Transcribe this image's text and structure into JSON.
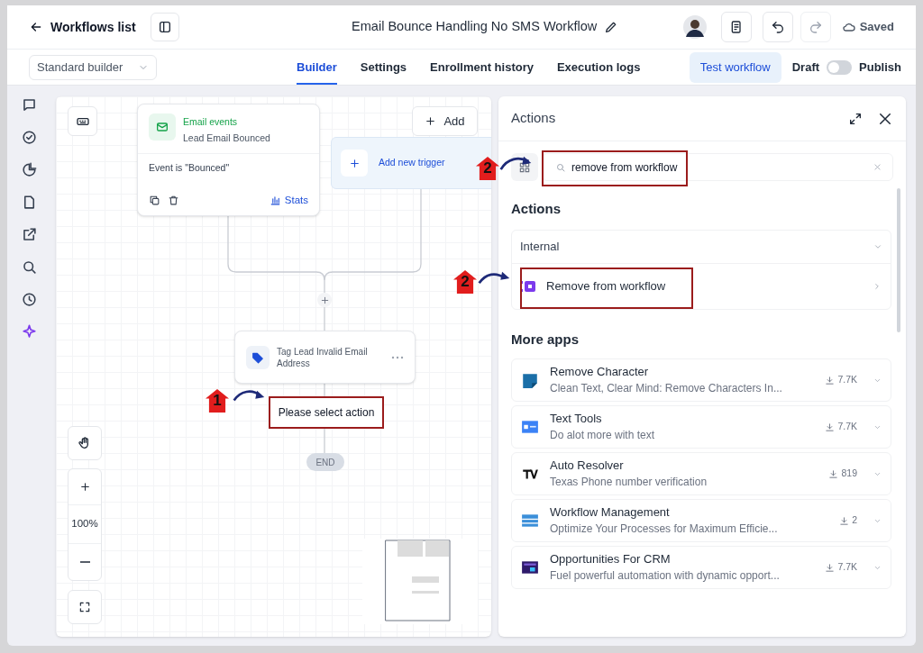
{
  "header": {
    "back_label": "Workflows list",
    "title": "Email Bounce Handling No SMS Workflow",
    "save_status": "Saved"
  },
  "toolbar": {
    "builder_select": "Standard builder",
    "tabs": [
      {
        "label": "Builder",
        "selected": true
      },
      {
        "label": "Settings",
        "selected": false
      },
      {
        "label": "Enrollment history",
        "selected": false
      },
      {
        "label": "Execution logs",
        "selected": false
      }
    ],
    "test_button": "Test workflow",
    "draft_label": "Draft",
    "publish_on": false,
    "publish_label": "Publish"
  },
  "canvas": {
    "trigger": {
      "category": "Email events",
      "name": "Lead Email Bounced",
      "condition": "Event is \"Bounced\"",
      "stats_label": "Stats"
    },
    "add_button": "Add",
    "add_trigger": "Add new trigger",
    "action": {
      "name": "Tag Lead Invalid Email Address"
    },
    "pending_step": "Please select action",
    "end_label": "END",
    "zoom": "100%"
  },
  "panel": {
    "title": "Actions",
    "search_value": "remove from workflow",
    "section_title": "Actions",
    "group_label": "Internal",
    "items": [
      {
        "label": "Remove from workflow"
      }
    ],
    "more_title": "More apps",
    "apps": [
      {
        "kind": "doc",
        "name": "Remove Character",
        "description": "Clean Text, Clear Mind: Remove Characters In...",
        "downloads": "7.7K"
      },
      {
        "kind": "text",
        "name": "Text Tools",
        "description": "Do alot more with text",
        "downloads": "7.7K"
      },
      {
        "kind": "mark",
        "name": "Auto Resolver",
        "description": "Texas Phone number verification",
        "downloads": "819"
      },
      {
        "kind": "bars",
        "name": "Workflow Management",
        "description": "Optimize Your Processes for Maximum Efficie...",
        "downloads": "2"
      },
      {
        "kind": "screen",
        "name": "Opportunities For CRM",
        "description": "Fuel powerful automation with dynamic opport...",
        "downloads": "7.7K"
      }
    ]
  },
  "annotations": [
    {
      "number": "2"
    },
    {
      "number": "2"
    },
    {
      "number": "1"
    }
  ]
}
